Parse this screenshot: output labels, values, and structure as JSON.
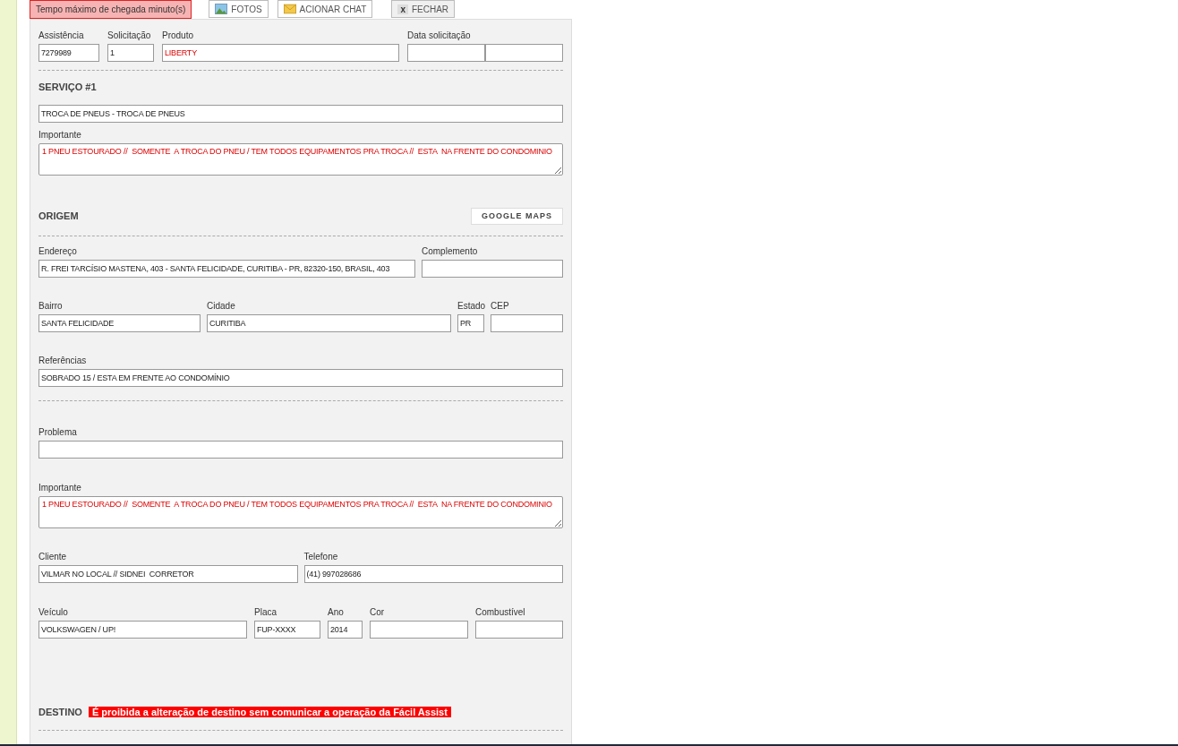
{
  "top_bar": {
    "deadline_notice": "Tempo máximo de chegada minuto(s)",
    "buttons": [
      {
        "kind": "photo",
        "label": "FOTOS"
      },
      {
        "kind": "chat",
        "label": "ACIONAR CHAT"
      },
      {
        "kind": "close",
        "icon_text": "x",
        "label": "FECHAR"
      }
    ]
  },
  "blocks": [
    {
      "kind": "row",
      "fields": [
        {
          "kind": "input",
          "label": "Assistência",
          "value": "7279989",
          "alert": false
        },
        {
          "kind": "input",
          "label": "Solicitação",
          "value": "1",
          "alert": false
        },
        {
          "kind": "input",
          "label": "Produto",
          "value": "LIBERTY",
          "alert": true
        },
        {
          "kind": "split",
          "label": "Data solicitação"
        }
      ]
    },
    {
      "kind": "divider"
    },
    {
      "kind": "heading",
      "title": "SERVIÇO #1"
    },
    {
      "kind": "row",
      "fields": [
        {
          "kind": "input",
          "value": "TROCA DE PNEUS - TROCA DE PNEUS",
          "alert": false
        }
      ]
    },
    {
      "kind": "row",
      "fields": [
        {
          "kind": "textarea",
          "label": "Importante",
          "value": "1 PNEU ESTOURADO //  SOMENTE  A TROCA DO PNEU / TEM TODOS EQUIPAMENTOS PRA TROCA //  ESTA  NA FRENTE DO CONDOMINIO",
          "alert": true
        }
      ]
    },
    {
      "kind": "heading",
      "title": "ORIGEM",
      "button": "GOOGLE MAPS"
    },
    {
      "kind": "divider"
    },
    {
      "kind": "row",
      "fields": [
        {
          "kind": "input",
          "label": "Endereço",
          "value": "R. FREI TARCÍSIO MASTENA, 403 - SANTA FELICIDADE, CURITIBA - PR, 82320-150, BRASIL, 403",
          "alert": false
        },
        {
          "kind": "input",
          "label": "Complemento"
        }
      ]
    },
    {
      "kind": "row",
      "fields": [
        {
          "kind": "input",
          "label": "Bairro",
          "value": "SANTA FELICIDADE",
          "alert": false
        },
        {
          "kind": "input",
          "label": "Cidade",
          "value": "CURITIBA",
          "alert": false
        },
        {
          "kind": "input",
          "label": "Estado",
          "value": "PR",
          "alert": false
        },
        {
          "kind": "input",
          "label": "CEP"
        }
      ]
    },
    {
      "kind": "row",
      "fields": [
        {
          "kind": "input",
          "label": "Referências",
          "value": "SOBRADO 15 / ESTA EM FRENTE AO CONDOMÍNIO",
          "alert": false
        }
      ]
    },
    {
      "kind": "divider"
    },
    {
      "kind": "row",
      "fields": [
        {
          "kind": "input",
          "label": "Problema"
        }
      ]
    },
    {
      "kind": "row",
      "fields": [
        {
          "kind": "textarea",
          "label": "Importante",
          "value": "1 PNEU ESTOURADO //  SOMENTE  A TROCA DO PNEU / TEM TODOS EQUIPAMENTOS PRA TROCA //  ESTA  NA FRENTE DO CONDOMINIO",
          "alert": true
        }
      ]
    },
    {
      "kind": "row",
      "fields": [
        {
          "kind": "input",
          "label": "Cliente",
          "value": "VILMAR NO LOCAL // SIDNEI  CORRETOR",
          "alert": false
        },
        {
          "kind": "input",
          "label": "Telefone",
          "value": "(41) 997028686",
          "alert": false
        }
      ]
    },
    {
      "kind": "row",
      "fields": [
        {
          "kind": "input",
          "label": "Veículo",
          "value": "VOLKSWAGEN / UP!",
          "alert": false
        },
        {
          "kind": "input",
          "label": "Placa",
          "value": "FUP-XXXX",
          "alert": false
        },
        {
          "kind": "input",
          "label": "Ano",
          "value": "2014",
          "alert": false
        },
        {
          "kind": "input",
          "label": "Cor"
        },
        {
          "kind": "input",
          "label": "Combustível"
        }
      ]
    },
    {
      "kind": "heading",
      "title": "DESTINO",
      "notice": "É proibida a alteração de destino sem comunicar a operação da Fácil Assist"
    },
    {
      "kind": "divider"
    }
  ]
}
